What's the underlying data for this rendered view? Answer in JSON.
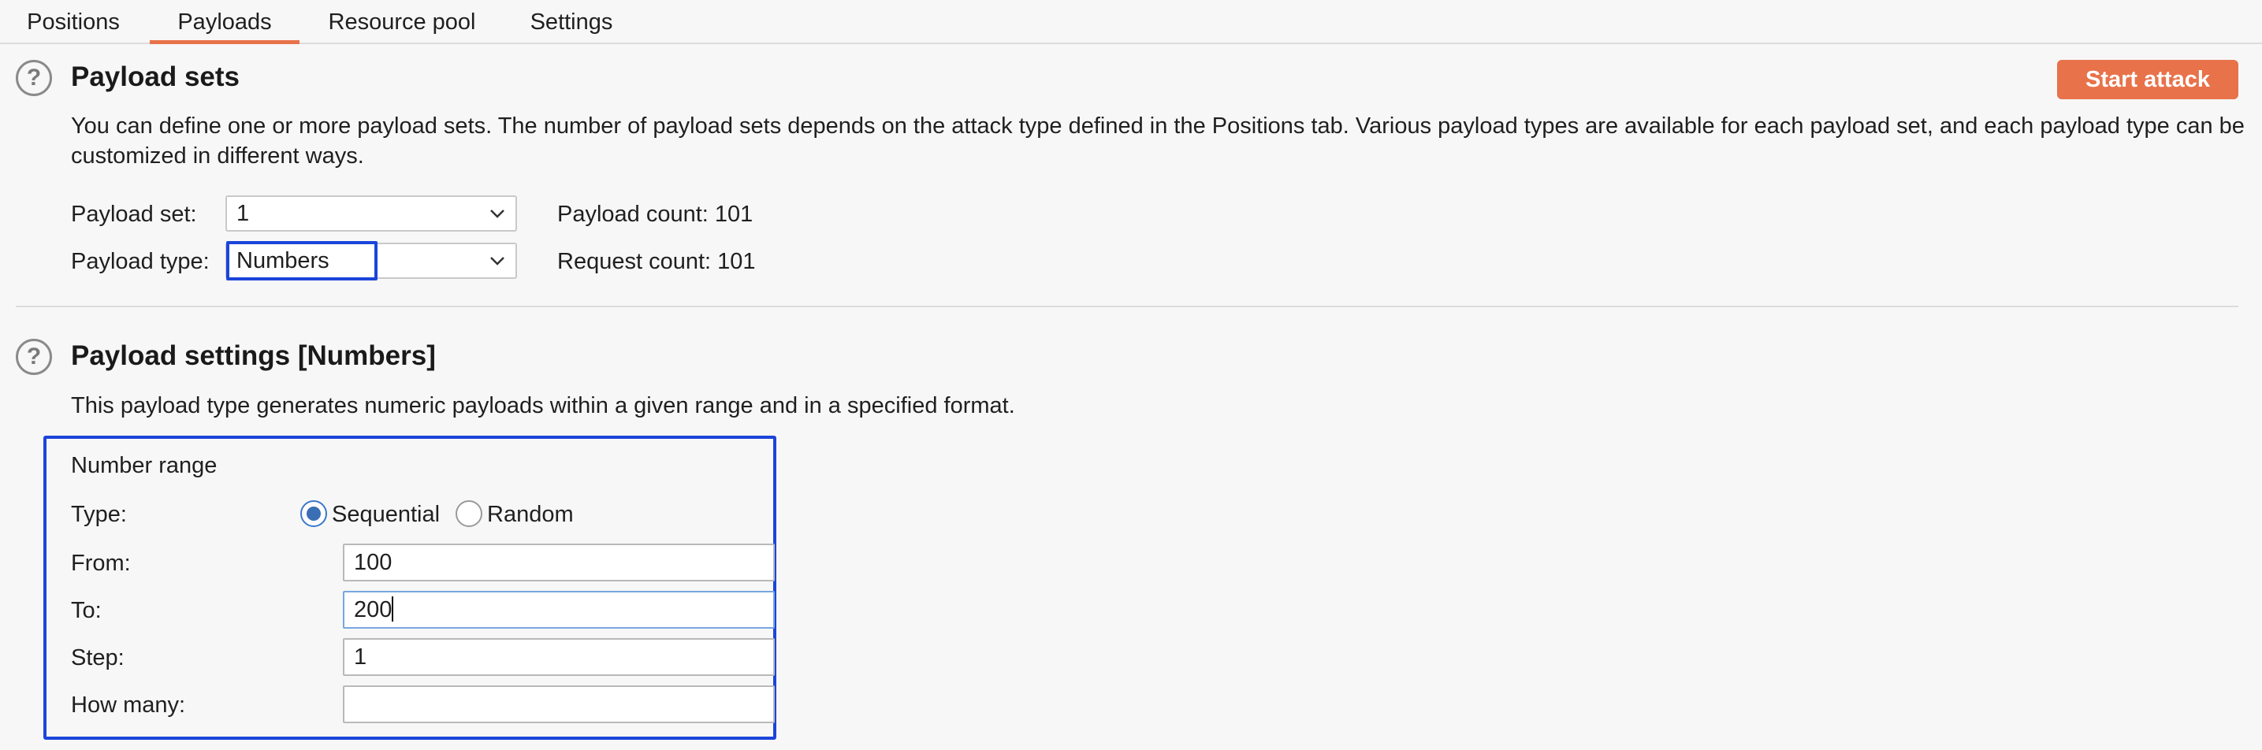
{
  "tabs": [
    {
      "label": "Positions",
      "active": false
    },
    {
      "label": "Payloads",
      "active": true
    },
    {
      "label": "Resource pool",
      "active": false
    },
    {
      "label": "Settings",
      "active": false
    }
  ],
  "payload_sets": {
    "title": "Payload sets",
    "description": "You can define one or more payload sets. The number of payload sets depends on the attack type defined in the Positions tab. Various payload types are available for each payload set, and each payload type can be customized in different ways.",
    "start_attack_label": "Start attack",
    "payload_set_label": "Payload set:",
    "payload_set_value": "1",
    "payload_type_label": "Payload type:",
    "payload_type_value": "Numbers",
    "payload_count": "Payload count: 101",
    "request_count": "Request count: 101"
  },
  "payload_settings": {
    "title": "Payload settings [Numbers]",
    "description": "This payload type generates numeric payloads within a given range and in a specified format.",
    "number_range": {
      "heading": "Number range",
      "type_label": "Type:",
      "options": [
        {
          "label": "Sequential",
          "selected": true
        },
        {
          "label": "Random",
          "selected": false
        }
      ],
      "from_label": "From:",
      "from_value": "100",
      "to_label": "To:",
      "to_value": "200",
      "step_label": "Step:",
      "step_value": "1",
      "how_many_label": "How many:",
      "how_many_value": ""
    }
  },
  "icons": {
    "help": "help-circle-icon",
    "dropdown": "chevron-down-icon"
  },
  "colors": {
    "accent": "#e8724a",
    "focus_outline": "#1b45d9",
    "radio_selected": "#3a6fb5"
  }
}
